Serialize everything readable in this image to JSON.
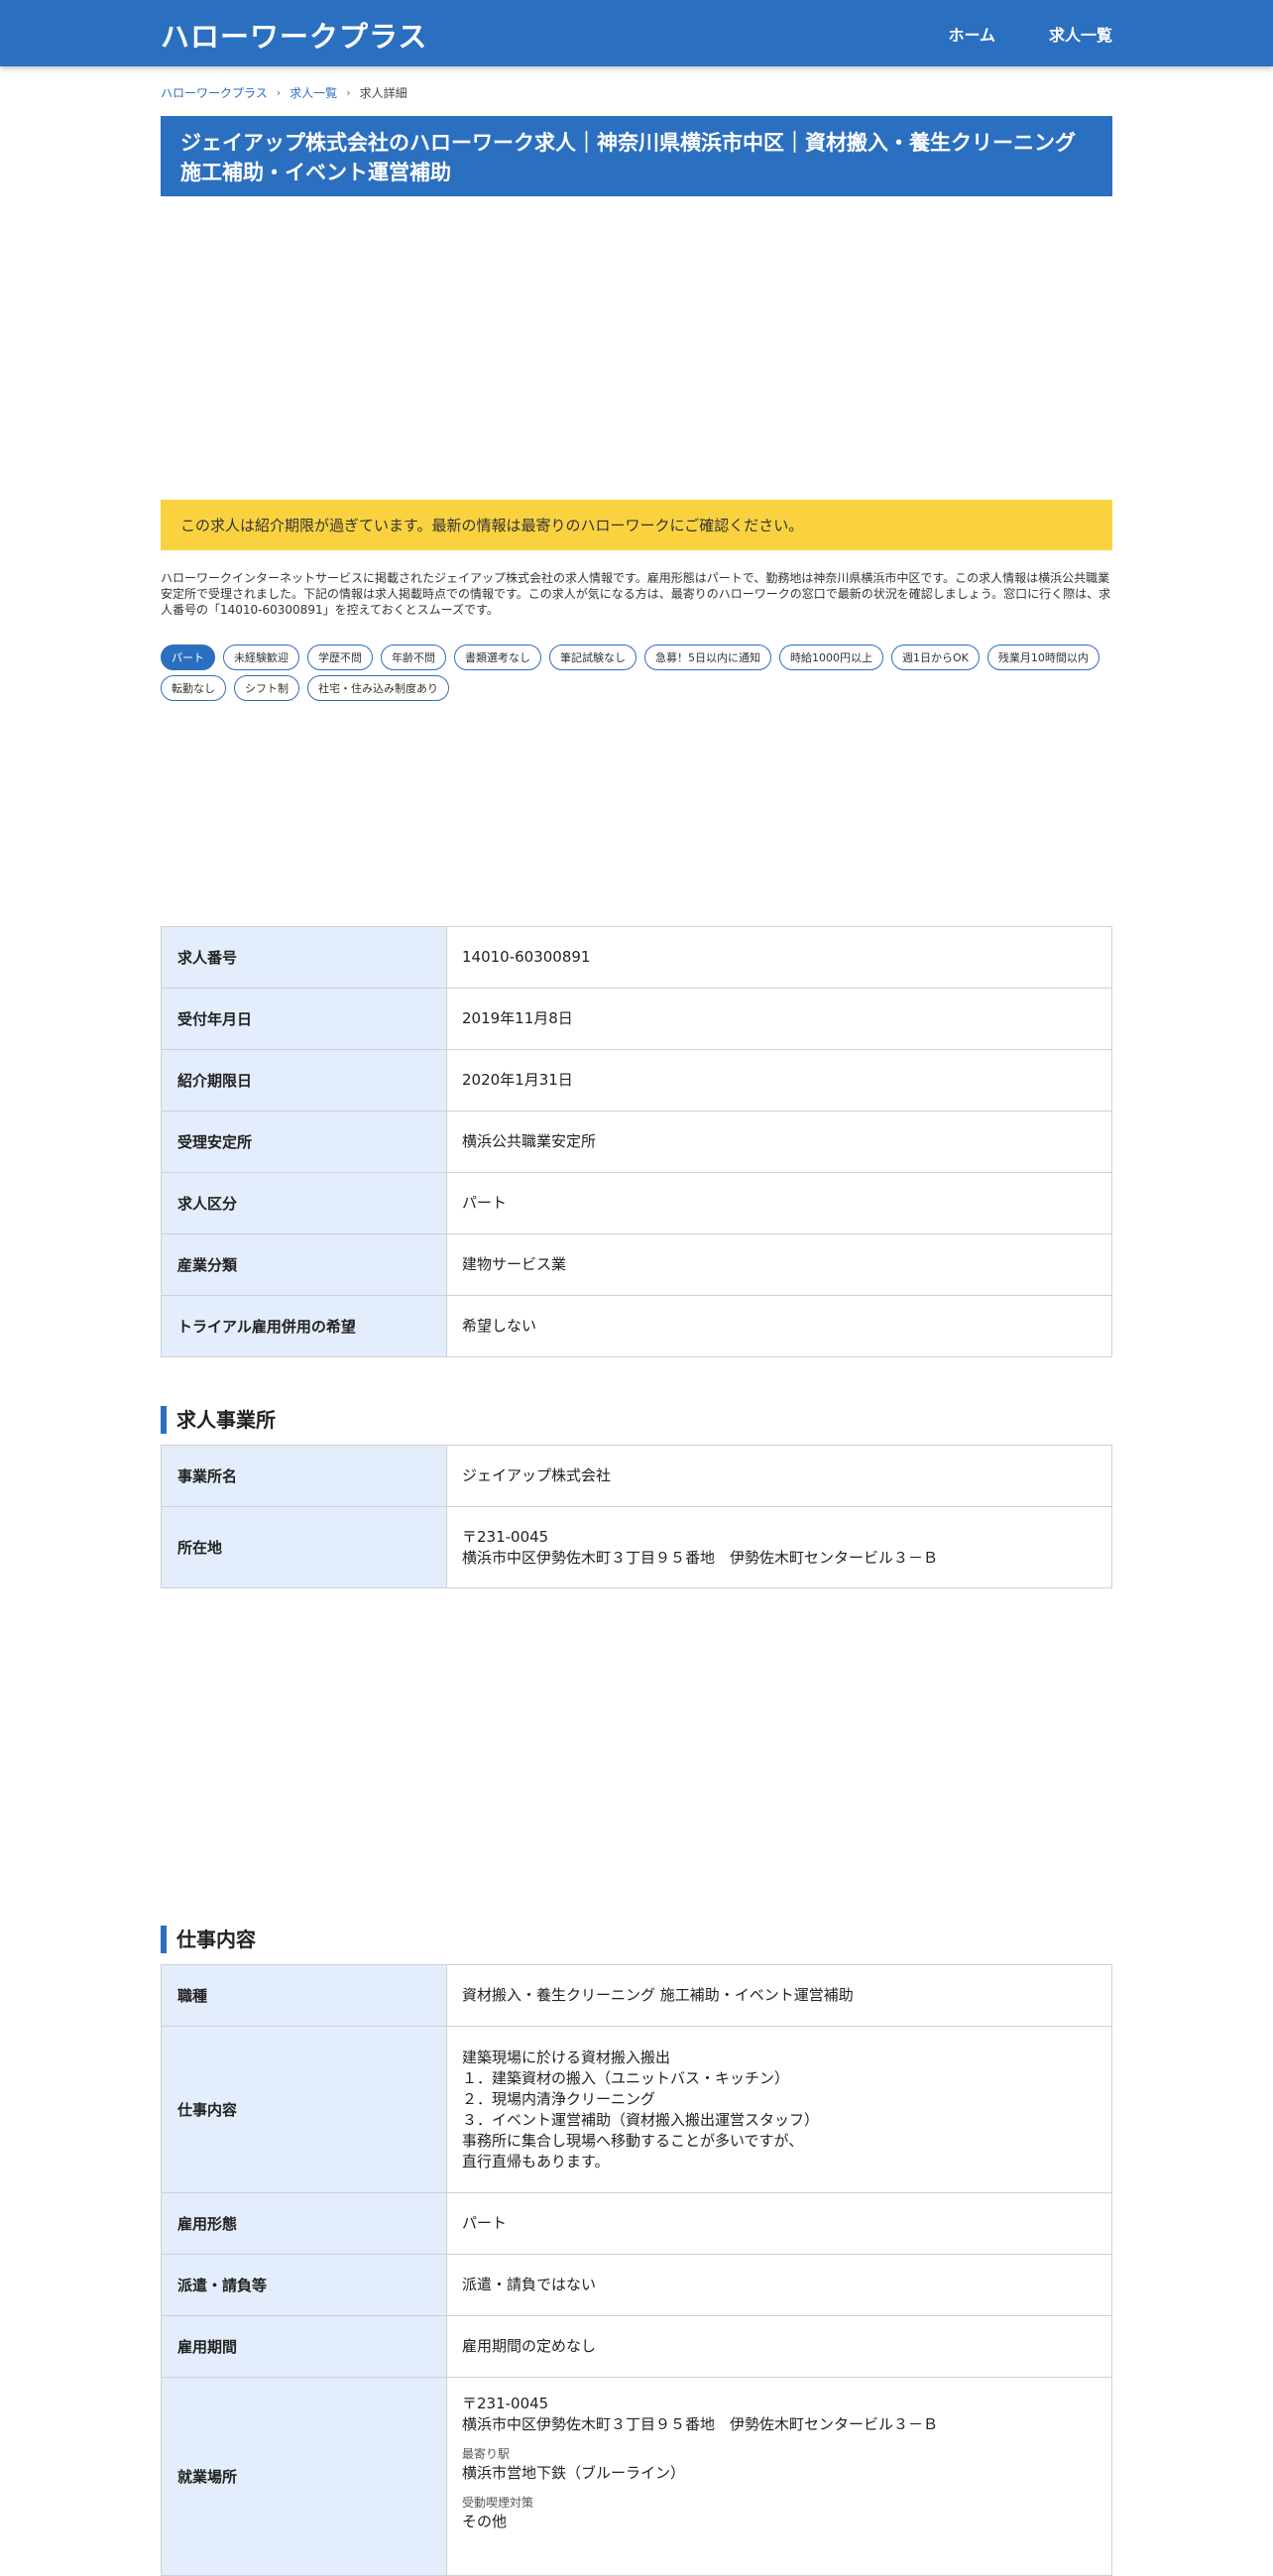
{
  "header": {
    "logo": "ハローワークプラス",
    "nav": [
      "ホーム",
      "求人一覧"
    ]
  },
  "breadcrumb": [
    "ハローワークプラス",
    "求人一覧",
    "求人詳細"
  ],
  "title": "ジェイアップ株式会社のハローワーク求人｜神奈川県横浜市中区｜資材搬入・養生クリーニング施工補助・イベント運営補助",
  "notice": "この求人は紹介期限が過ぎています。最新の情報は最寄りのハローワークにご確認ください。",
  "description": "ハローワークインターネットサービスに掲載されたジェイアップ株式会社の求人情報です。雇用形態はパートで、勤務地は神奈川県横浜市中区です。この求人情報は横浜公共職業安定所で受理されました。下記の情報は求人掲載時点での情報です。この求人が気になる方は、最寄りのハローワークの窓口で最新の状況を確認しましょう。窓口に行く際は、求人番号の「14010-60300891」を控えておくとスムーズです。",
  "tags": [
    "パート",
    "未経験歓迎",
    "学歴不問",
    "年齢不問",
    "書類選考なし",
    "筆記試験なし",
    "急募！5日以内に通知",
    "時給1000円以上",
    "週1日からOK",
    "残業月10時間以内",
    "転勤なし",
    "シフト制",
    "社宅・住み込み制度あり"
  ],
  "job_info": [
    {
      "label": "求人番号",
      "value": "14010-60300891"
    },
    {
      "label": "受付年月日",
      "value": "2019年11月8日"
    },
    {
      "label": "紹介期限日",
      "value": "2020年1月31日"
    },
    {
      "label": "受理安定所",
      "value": "横浜公共職業安定所"
    },
    {
      "label": "求人区分",
      "value": "パート"
    },
    {
      "label": "産業分類",
      "value": "建物サービス業"
    },
    {
      "label": "トライアル雇用併用の希望",
      "value": "希望しない"
    }
  ],
  "office": {
    "heading": "求人事業所",
    "name_label": "事業所名",
    "name": "ジェイアップ株式会社",
    "address_label": "所在地",
    "postal": "〒231-0045",
    "address": "横浜市中区伊勢佐木町３丁目９５番地　伊勢佐木町センタービル３－Ｂ"
  },
  "work": {
    "heading": "仕事内容",
    "job_type_label": "職種",
    "job_type": "資材搬入・養生クリーニング 施工補助・イベント運営補助",
    "content_label": "仕事内容",
    "content": "建築現場に於ける資材搬入搬出\n１．建築資材の搬入（ユニットバス・キッチン）\n２．現場内清浄クリーニング\n３．イベント運営補助（資材搬入搬出運営スタッフ）\n事務所に集合し現場へ移動することが多いですが、\n直行直帰もあります。",
    "employment_label": "雇用形態",
    "employment": "パート",
    "dispatch_label": "派遣・請負等",
    "dispatch": "派遣・請負ではない",
    "period_label": "雇用期間",
    "period": "雇用期間の定めなし",
    "place_label": "就業場所",
    "place_postal": "〒231-0045",
    "place_address": "横浜市中区伊勢佐木町３丁目９５番地　伊勢佐木町センタービル３－Ｂ",
    "station_label": "最寄り駅",
    "station": "横浜市営地下鉄（ブルーライン）",
    "smoking_label": "受動喫煙対策",
    "smoking": "その他"
  }
}
